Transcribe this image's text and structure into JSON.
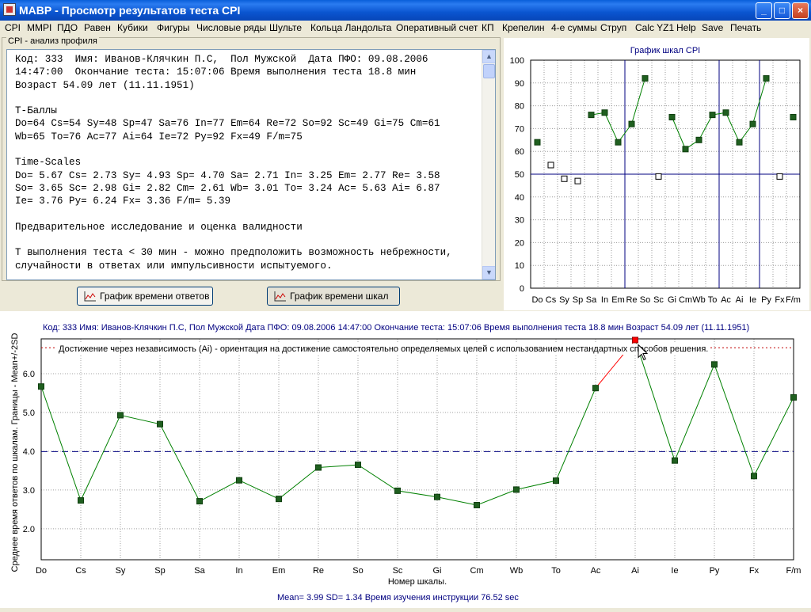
{
  "window": {
    "title": "МАВР - Просмотр результатов теста CPI",
    "buttons": {
      "minimize": "_",
      "maximize": "□",
      "close": "×"
    }
  },
  "menu": [
    "CPI",
    "MMPI",
    "ПДО",
    "Равен",
    "Кубики",
    "Фигуры",
    "Числовые ряды",
    "Шульте",
    "Кольца Ландольта",
    "Оперативный счет",
    "КП",
    "Крепелин",
    "4-е суммы",
    "Струп",
    "Calc YZ1",
    "Help",
    "Save",
    "Печать"
  ],
  "profile": {
    "group_label": "CPI - анализ профиля",
    "lines": [
      "Код: 333  Имя: Иванов-Клячкин П.С,  Пол Мужской  Дата ПФО: 09.08.2006",
      "14:47:00  Окончание теста: 15:07:06 Время выполнения теста 18.8 мин",
      "Возраст 54.09 лет (11.11.1951)",
      "",
      "T-Баллы",
      "Do=64 Cs=54 Sy=48 Sp=47 Sa=76 In=77 Em=64 Re=72 So=92 Sc=49 Gi=75 Cm=61",
      "Wb=65 To=76 Ac=77 Ai=64 Ie=72 Py=92 Fx=49 F/m=75",
      "",
      "Time-Scales",
      "Do= 5.67 Cs= 2.73 Sy= 4.93 Sp= 4.70 Sa= 2.71 In= 3.25 Em= 2.77 Re= 3.58",
      "So= 3.65 Sc= 2.98 Gi= 2.82 Cm= 2.61 Wb= 3.01 To= 3.24 Ac= 5.63 Ai= 6.87",
      "Ie= 3.76 Py= 6.24 Fx= 3.36 F/m= 5.39",
      "",
      "Предварительное исследование и оценка валидности",
      "",
      "T выполнения теста < 30 мин - можно предположить возможность небрежности,",
      "случайности в ответах или импульсивности испытуемого."
    ]
  },
  "buttons": {
    "response_time_chart": "График времени ответов",
    "scale_time_chart": "График времени шкал"
  },
  "chart_data": [
    {
      "type": "line",
      "title": "График шкал CPI",
      "categories": [
        "Do",
        "Cs",
        "Sy",
        "Sp",
        "Sa",
        "In",
        "Em",
        "Re",
        "So",
        "Sc",
        "Gi",
        "Cm",
        "Wb",
        "To",
        "Ac",
        "Ai",
        "Ie",
        "Py",
        "Fx",
        "F/m"
      ],
      "values": [
        64,
        54,
        48,
        47,
        76,
        77,
        64,
        72,
        92,
        49,
        75,
        61,
        65,
        76,
        77,
        64,
        72,
        92,
        49,
        75
      ],
      "segments": [
        [
          0,
          0
        ],
        [
          4,
          8
        ],
        [
          10,
          17
        ],
        [
          19,
          19
        ]
      ],
      "hollow_points": [
        1,
        2,
        3,
        9,
        18
      ],
      "ylim": [
        0,
        100
      ],
      "yticks": [
        0,
        10,
        20,
        30,
        40,
        50,
        60,
        70,
        80,
        90,
        100
      ],
      "reference_line": 50,
      "vertical_lines_after": [
        "Em",
        "To",
        "Ie"
      ],
      "grid": true,
      "colors": {
        "line": "#008000",
        "marker": "#1f5f1f",
        "reference": "#000080",
        "title": "#000080"
      }
    },
    {
      "type": "line",
      "info": "Код: 333  Имя: Иванов-Клячкин П.С,  Пол Мужской  Дата ПФО: 09.08.2006 14:47:00 Окончание теста: 15:07:06 Время выполнения теста 18.8 мин Возраст 54.09 лет (11.11.1951)",
      "annotation": "Достижение через независимость (Ai) - ориентация на достижение самостоятельно определяемых целей с использованием нестандартных способов решения.",
      "categories": [
        "Do",
        "Cs",
        "Sy",
        "Sp",
        "Sa",
        "In",
        "Em",
        "Re",
        "So",
        "Sc",
        "Gi",
        "Cm",
        "Wb",
        "To",
        "Ac",
        "Ai",
        "Ie",
        "Py",
        "Fx",
        "F/m"
      ],
      "values": [
        5.67,
        2.73,
        4.93,
        4.7,
        2.71,
        3.25,
        2.77,
        3.58,
        3.65,
        2.98,
        2.82,
        2.61,
        3.01,
        3.24,
        5.63,
        6.87,
        3.76,
        6.24,
        3.36,
        5.39
      ],
      "highlight_index": 15,
      "ylim": [
        1.2,
        6.9
      ],
      "yticks": [
        2.0,
        3.0,
        4.0,
        5.0,
        6.0
      ],
      "mean_line": 3.99,
      "upper_bound_line": 6.67,
      "xlabel": "Номер шкалы.",
      "ylabel": "Среднее время ответов по шкалам. Границы - Mean+/-2SD",
      "footer": "Mean= 3.99  SD= 1.34 Время изучения инструкции  76.52 sec",
      "grid": true,
      "colors": {
        "line": "#008000",
        "marker": "#1f5f1f",
        "highlight": "#ff0000",
        "mean": "#000080",
        "bound": "#c00000",
        "text": "#000080"
      }
    }
  ]
}
